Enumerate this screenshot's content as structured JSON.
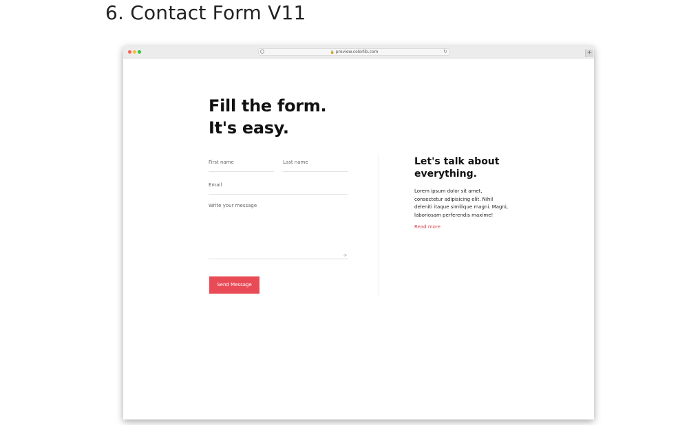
{
  "article": {
    "title": "6. Contact Form V11"
  },
  "browser": {
    "url": "preview.colorlib.com"
  },
  "form": {
    "heading_line1": "Fill the form.",
    "heading_line2": "It's easy.",
    "first_name_placeholder": "First name",
    "last_name_placeholder": "Last name",
    "email_placeholder": "Email",
    "message_placeholder": "Write your message",
    "send_label": "Send Message"
  },
  "aside": {
    "heading_line1": "Let's talk about",
    "heading_line2": "everything.",
    "text": "Lorem ipsum dolor sit amet, consectetur adipisicing elit. Nihil deleniti itaque similique magni. Magni, laboriosam perferendis maxime!",
    "read_more": "Read more"
  },
  "colors": {
    "accent": "#e84a56",
    "link": "#d9444f",
    "traffic_close": "#fc5f57",
    "traffic_minimize": "#fdbc2e",
    "traffic_maximize": "#28c840"
  },
  "icons": [
    "info-icon",
    "lock-icon",
    "reload-icon",
    "plus-icon",
    "resize-handle-icon"
  ]
}
